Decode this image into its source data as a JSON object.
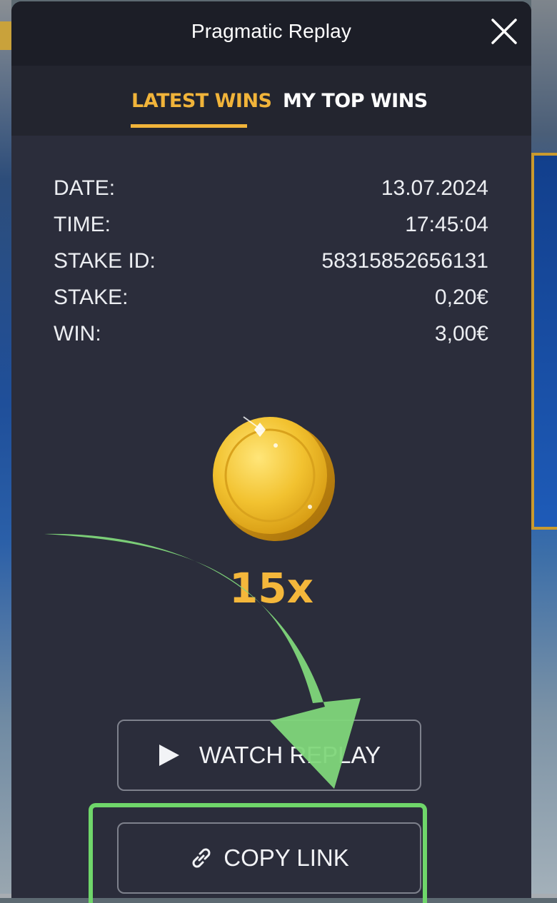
{
  "modal": {
    "title": "Pragmatic Replay",
    "close_icon": "close-icon"
  },
  "tabs": [
    {
      "label": "LATEST WINS",
      "active": true
    },
    {
      "label": "MY TOP WINS",
      "active": false
    }
  ],
  "details": [
    {
      "label": "DATE:",
      "value": "13.07.2024"
    },
    {
      "label": "TIME:",
      "value": "17:45:04"
    },
    {
      "label": "STAKE ID:",
      "value": "58315852656131"
    },
    {
      "label": "STAKE:",
      "value": "0,20€"
    },
    {
      "label": "WIN:",
      "value": "3,00€"
    }
  ],
  "multiplier": "15x",
  "buttons": {
    "watch_replay": "WATCH REPLAY",
    "copy_link": "COPY LINK"
  },
  "colors": {
    "accent": "#f1b43a",
    "modal_bg": "#2b2d3b",
    "header_bg": "#1c1e27",
    "highlight": "#6fd66a"
  },
  "icons": [
    "close-icon",
    "gold-coin-icon",
    "play-icon",
    "link-icon",
    "green-arrow-overlay"
  ]
}
